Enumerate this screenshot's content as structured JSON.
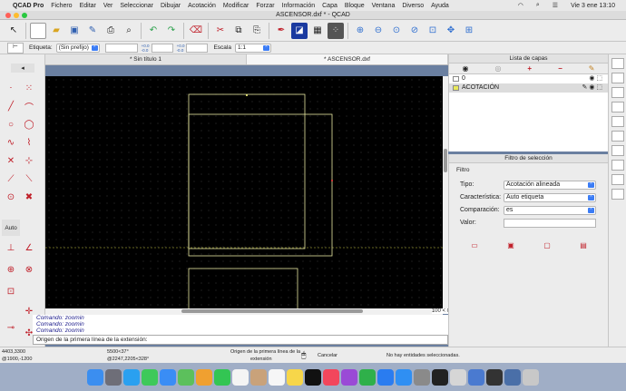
{
  "menubar": {
    "app": "QCAD Pro",
    "items": [
      "Fichero",
      "Editar",
      "Ver",
      "Seleccionar",
      "Dibujar",
      "Acotación",
      "Modificar",
      "Forzar",
      "Información",
      "Capa",
      "Bloque",
      "Ventana",
      "Diverso",
      "Ayuda"
    ],
    "clock": "Vie 3 ene 13:10"
  },
  "window": {
    "title": "ASCENSOR.dxf * - QCAD"
  },
  "optionsbar": {
    "label_etiqueta": "Etiqueta:",
    "prefix_select": "(Sin prefijo)",
    "label_escala": "Escala",
    "scale_select": "1:1"
  },
  "tabs": [
    {
      "label": "* Sin título 1"
    },
    {
      "label": "* ASCENSOR.dxf"
    }
  ],
  "canvas": {
    "scroll_label": "100 < 0"
  },
  "leftbar": {
    "auto_label": "Auto"
  },
  "command": {
    "history": [
      "Comando: zoomin",
      "Comando: zoomin",
      "Comando: zoomin"
    ],
    "prompt": "Origen de la primera línea de la extensión:"
  },
  "status": {
    "coord_abs": "4403,3300",
    "coord_rel": "@1900,-1200",
    "coord_polar_abs": "5500<37°",
    "coord_polar_rel": "@2247,2205<328°",
    "prompt_line1": "Origen de la primera línea de la",
    "prompt_line2": "extensión",
    "mouse_hint": "Cancelar",
    "selection": "No hay entidades seleccionadas."
  },
  "layers_panel": {
    "title": "Lista de capas",
    "layers": [
      {
        "name": "0",
        "color": "#ffffff"
      },
      {
        "name": "ACOTACIÓN",
        "color": "#e8e85a"
      }
    ]
  },
  "filter_panel": {
    "title": "Filtro de selección",
    "group": "Filtro",
    "tipo_label": "Tipo:",
    "tipo_value": "Acotación alineada",
    "caracteristica_label": "Característica:",
    "caracteristica_value": "Auto etiqueta",
    "comparacion_label": "Comparación:",
    "comparacion_value": "es",
    "valor_label": "Valor:",
    "valor_value": ""
  },
  "colors": {
    "accent": "#3b7cf5",
    "canvas_bg": "#000000",
    "drawing_line": "#e8e8a0"
  }
}
